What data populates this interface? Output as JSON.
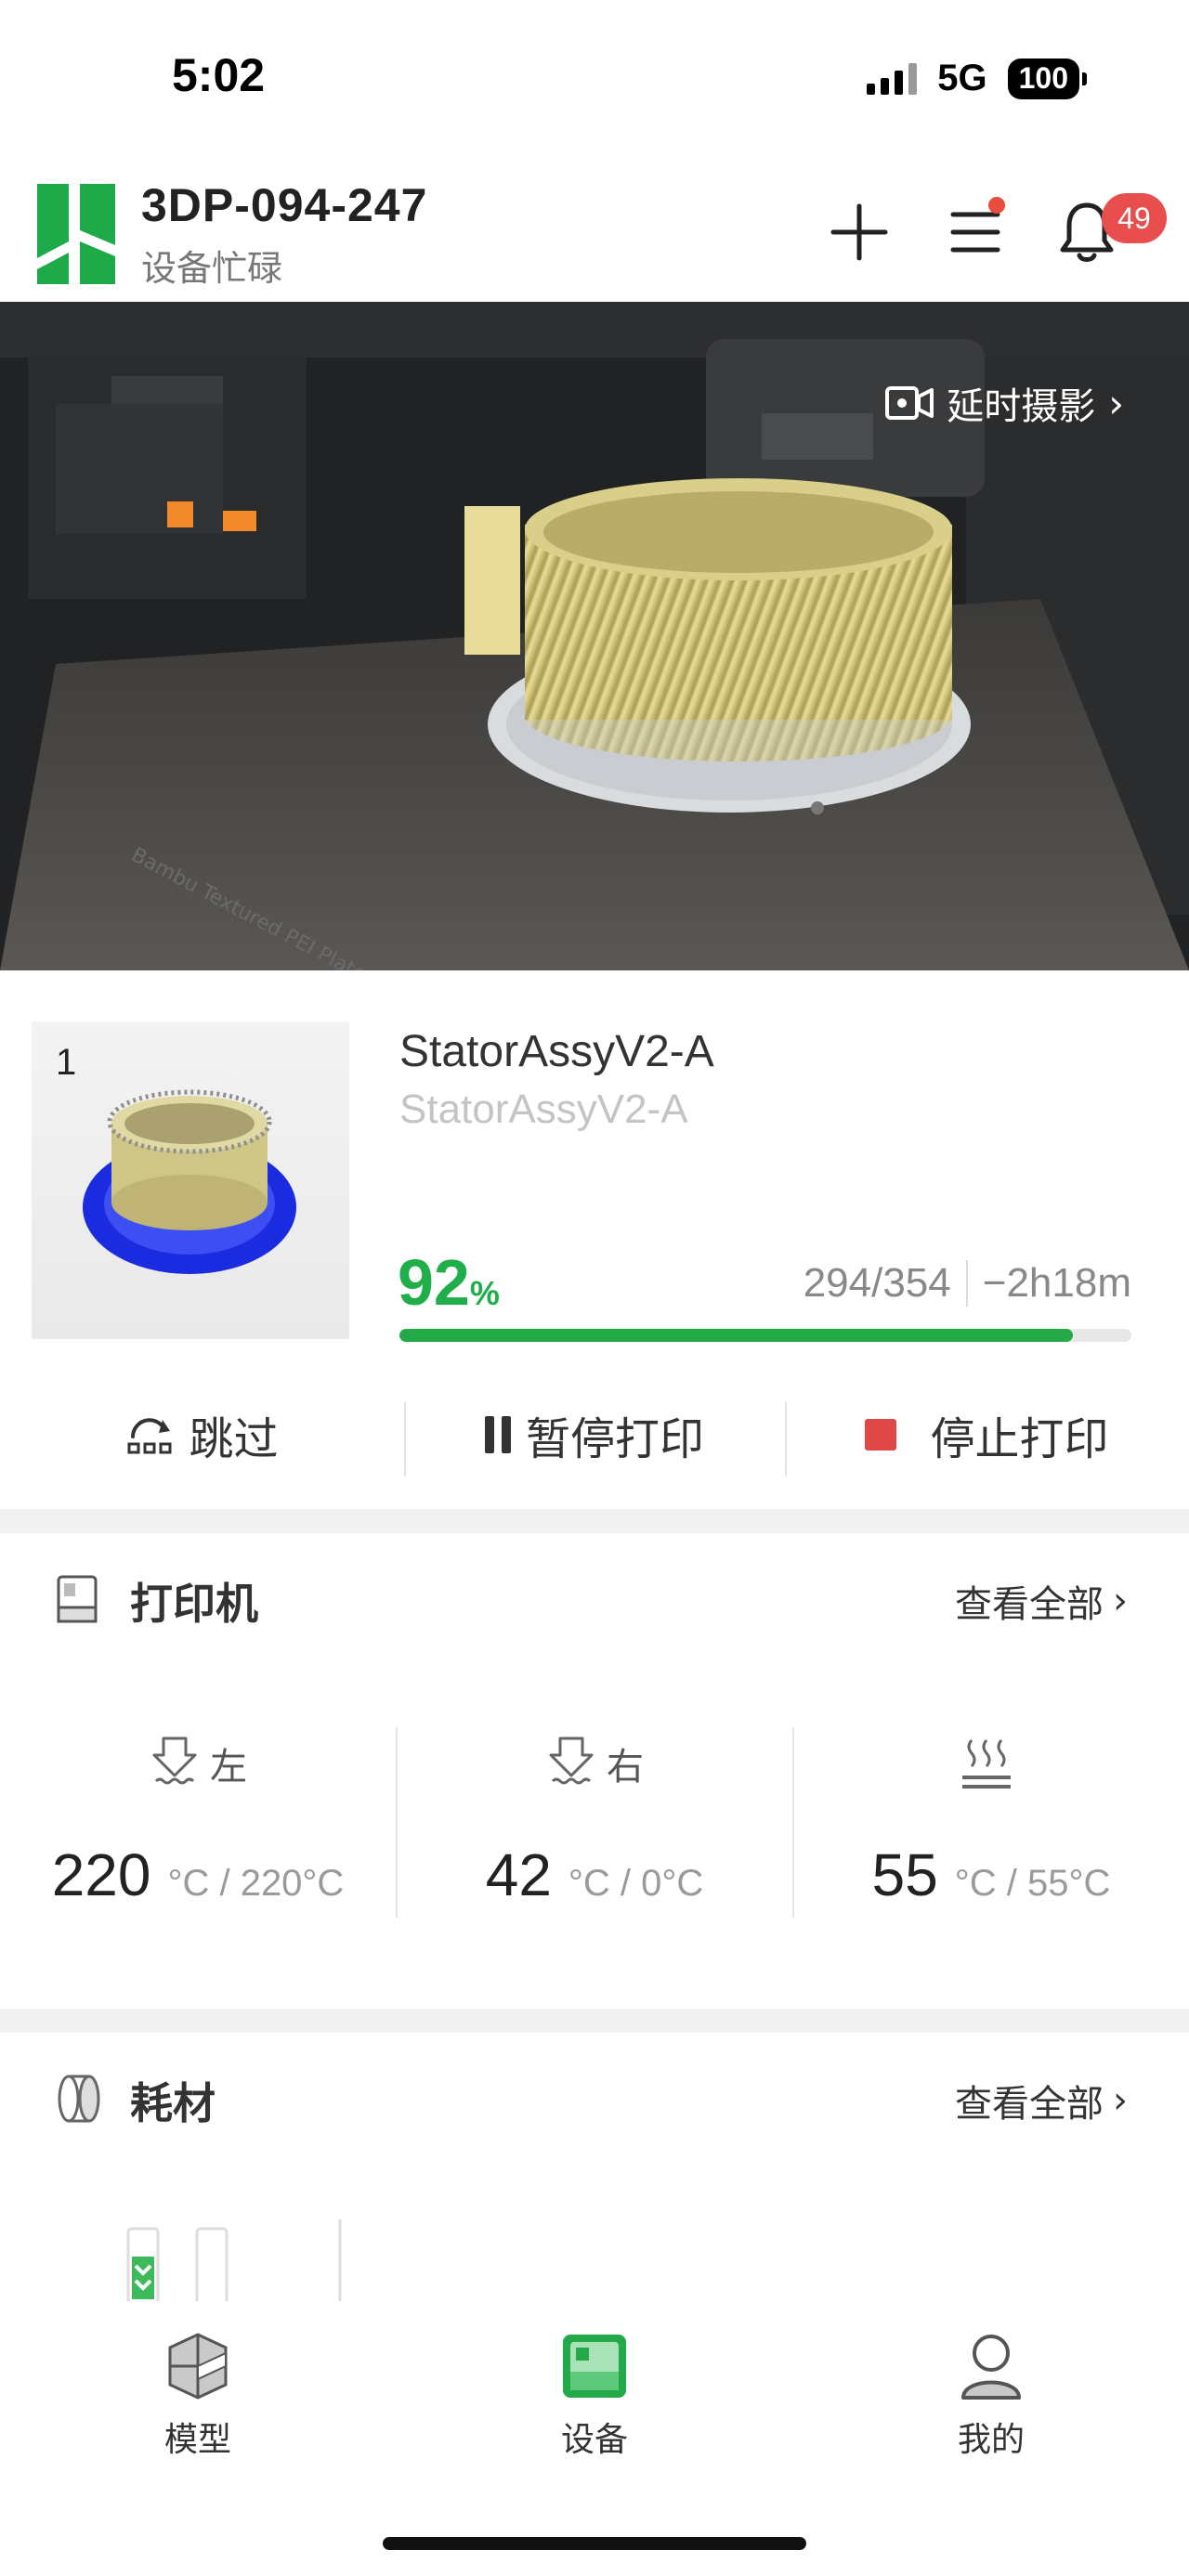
{
  "status_bar": {
    "time": "5:02",
    "network": "5G",
    "battery": "100"
  },
  "header": {
    "device_name": "3DP-094-247",
    "device_status": "设备忙碌",
    "notification_count": "49"
  },
  "camera": {
    "timelapse_label": "延时摄影"
  },
  "job": {
    "plate_number": "1",
    "title": "StatorAssyV2-A",
    "subtitle": "StatorAssyV2-A",
    "progress_percent": 92,
    "progress_value": "92",
    "progress_unit": "%",
    "layers": "294/354",
    "remaining": "−2h18m",
    "actions": {
      "skip": "跳过",
      "pause": "暂停打印",
      "stop": "停止打印"
    }
  },
  "printer_card": {
    "title": "打印机",
    "view_all": "查看全部",
    "temps": [
      {
        "label": "左",
        "current": "220",
        "target": "°C / 220°C"
      },
      {
        "label": "右",
        "current": "42",
        "target": "°C / 0°C"
      },
      {
        "label": "",
        "current": "55",
        "target": "°C / 55°C"
      }
    ]
  },
  "filament_card": {
    "title": "耗材",
    "view_all": "查看全部"
  },
  "bottom_nav": {
    "models": "模型",
    "devices": "设备",
    "mine": "我的"
  },
  "colors": {
    "brand_green": "#23a946",
    "stop_red": "#e04848",
    "badge_red": "#e94e4e"
  }
}
